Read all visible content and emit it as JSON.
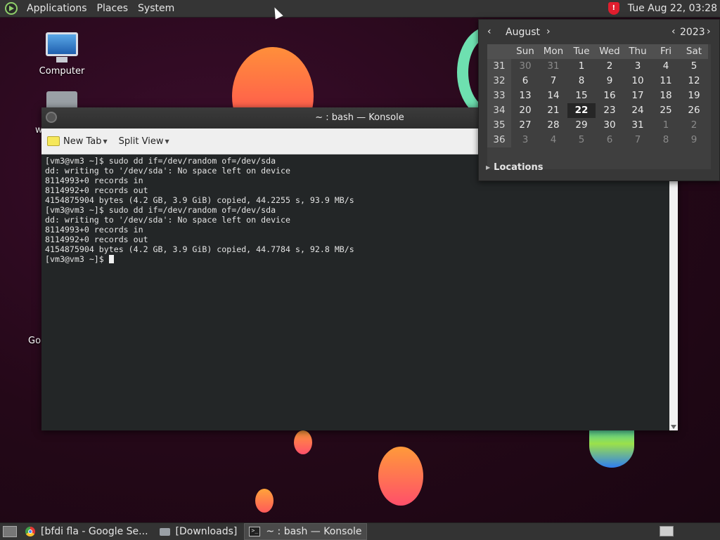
{
  "top_panel": {
    "menus": [
      "Applications",
      "Places",
      "System"
    ],
    "clock": "Tue Aug 22, 03:28"
  },
  "desktop": {
    "icons": [
      {
        "label": "Computer"
      }
    ],
    "fragments": [
      "w",
      "Go"
    ]
  },
  "konsole": {
    "title": "~ : bash — Konsole",
    "toolbar": {
      "new_tab": "New Tab",
      "split_view": "Split View"
    },
    "terminal_lines": [
      "[vm3@vm3 ~]$ sudo dd if=/dev/random of=/dev/sda",
      "dd: writing to '/dev/sda': No space left on device",
      "8114993+0 records in",
      "8114992+0 records out",
      "4154875904 bytes (4.2 GB, 3.9 GiB) copied, 44.2255 s, 93.9 MB/s",
      "[vm3@vm3 ~]$ sudo dd if=/dev/random of=/dev/sda",
      "dd: writing to '/dev/sda': No space left on device",
      "8114993+0 records in",
      "8114992+0 records out",
      "4154875904 bytes (4.2 GB, 3.9 GiB) copied, 44.7784 s, 92.8 MB/s"
    ],
    "prompt": "[vm3@vm3 ~]$ "
  },
  "calendar": {
    "month": "August",
    "year": "2023",
    "weekdays": [
      "Sun",
      "Mon",
      "Tue",
      "Wed",
      "Thu",
      "Fri",
      "Sat"
    ],
    "today": "22",
    "weeks": [
      {
        "wk": "31",
        "days": [
          {
            "d": "30",
            "dim": true
          },
          {
            "d": "31",
            "dim": true
          },
          {
            "d": "1"
          },
          {
            "d": "2"
          },
          {
            "d": "3"
          },
          {
            "d": "4"
          },
          {
            "d": "5"
          }
        ]
      },
      {
        "wk": "32",
        "days": [
          {
            "d": "6"
          },
          {
            "d": "7"
          },
          {
            "d": "8"
          },
          {
            "d": "9"
          },
          {
            "d": "10"
          },
          {
            "d": "11"
          },
          {
            "d": "12"
          }
        ]
      },
      {
        "wk": "33",
        "days": [
          {
            "d": "13"
          },
          {
            "d": "14"
          },
          {
            "d": "15"
          },
          {
            "d": "16"
          },
          {
            "d": "17"
          },
          {
            "d": "18"
          },
          {
            "d": "19"
          }
        ]
      },
      {
        "wk": "34",
        "days": [
          {
            "d": "20"
          },
          {
            "d": "21"
          },
          {
            "d": "22"
          },
          {
            "d": "23"
          },
          {
            "d": "24"
          },
          {
            "d": "25"
          },
          {
            "d": "26"
          }
        ]
      },
      {
        "wk": "35",
        "days": [
          {
            "d": "27"
          },
          {
            "d": "28"
          },
          {
            "d": "29"
          },
          {
            "d": "30"
          },
          {
            "d": "31"
          },
          {
            "d": "1",
            "dim": true
          },
          {
            "d": "2",
            "dim": true
          }
        ]
      },
      {
        "wk": "36",
        "days": [
          {
            "d": "3",
            "dim": true
          },
          {
            "d": "4",
            "dim": true
          },
          {
            "d": "5",
            "dim": true
          },
          {
            "d": "6",
            "dim": true
          },
          {
            "d": "7",
            "dim": true
          },
          {
            "d": "8",
            "dim": true
          },
          {
            "d": "9",
            "dim": true
          }
        ]
      }
    ],
    "locations_label": "Locations"
  },
  "taskbar": {
    "tasks": [
      {
        "label": "[bfdi fla - Google Se...",
        "icon": "chrome-icon"
      },
      {
        "label": "[Downloads]",
        "icon": "folder-icon"
      },
      {
        "label": "~ : bash — Konsole",
        "icon": "terminal-icon",
        "active": true
      }
    ]
  },
  "colors": {
    "panel": "#353535",
    "terminal_bg": "#232627",
    "accent_shield": "#e01e2e"
  }
}
